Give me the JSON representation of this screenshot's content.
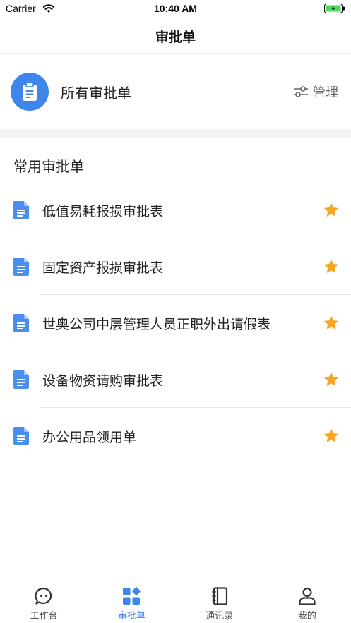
{
  "status_bar": {
    "carrier": "Carrier",
    "time": "10:40 AM"
  },
  "nav": {
    "title": "审批单"
  },
  "all_forms": {
    "label": "所有审批单",
    "manage_label": "管理"
  },
  "common_section": {
    "title": "常用审批单",
    "items": [
      {
        "label": "低值易耗报损审批表",
        "starred": true
      },
      {
        "label": "固定资产报损审批表",
        "starred": true
      },
      {
        "label": "世奥公司中层管理人员正职外出请假表",
        "starred": true
      },
      {
        "label": "设备物资请购审批表",
        "starred": true
      },
      {
        "label": "办公用品领用单",
        "starred": true
      }
    ]
  },
  "tab_bar": {
    "tabs": [
      {
        "label": "工作台",
        "icon": "chat-bubble-icon",
        "active": false
      },
      {
        "label": "审批单",
        "icon": "grid-icon",
        "active": true
      },
      {
        "label": "通讯录",
        "icon": "contacts-book-icon",
        "active": false
      },
      {
        "label": "我的",
        "icon": "person-icon",
        "active": false
      }
    ]
  },
  "colors": {
    "accent": "#3f86ea",
    "star": "#f6a623",
    "doc_icon": "#4a8ff0",
    "battery": "#4cd964"
  }
}
